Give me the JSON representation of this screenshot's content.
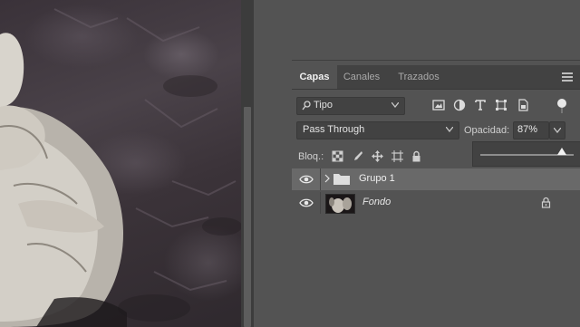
{
  "layers_panel": {
    "tabs": [
      {
        "label": "Capas",
        "active": true
      },
      {
        "label": "Canales",
        "active": false
      },
      {
        "label": "Trazados",
        "active": false
      }
    ],
    "filter": {
      "selected": "Tipo",
      "icons": [
        "image-filter-icon",
        "adjustment-filter-icon",
        "type-filter-icon",
        "shape-filter-icon",
        "smart-object-filter-icon"
      ]
    },
    "blend_mode": "Pass Through",
    "opacity": {
      "label": "Opacidad:",
      "value": "87%",
      "slider_fraction": 0.87
    },
    "lock": {
      "label": "Bloq.:",
      "icons": [
        "lock-transparent-icon",
        "lock-image-icon",
        "lock-position-icon",
        "lock-artboard-icon",
        "lock-all-icon"
      ]
    },
    "layers": [
      {
        "name": "Grupo 1",
        "type": "group",
        "visible": true,
        "selected": true
      },
      {
        "name": "Fondo",
        "type": "image",
        "visible": true,
        "locked": true
      }
    ]
  },
  "colors": {
    "panel_bg": "#535353",
    "tab_bar_bg": "#424242",
    "selected_layer_bg": "#696969"
  }
}
